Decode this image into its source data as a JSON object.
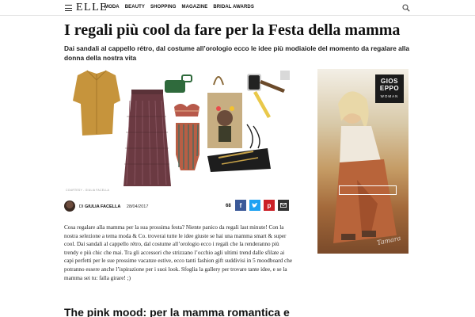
{
  "header": {
    "logo": "ELLE",
    "nav": [
      "MODA",
      "BEAUTY",
      "SHOPPING",
      "MAGAZINE",
      "BRIDAL AWARDS"
    ]
  },
  "article": {
    "title": "I regali più cool da fare per la Festa della mamma",
    "subtitle": "Dai sandali al cappello rétro, dal costume all’orologio ecco le idee più modiaiole del momento da regalare alla donna della nostra vita",
    "image_credit": "COURTESY - GIULIA FACELLA",
    "author_prefix": "DI",
    "author": "GIULIA FACELLA",
    "date": "28/04/2017",
    "share_count": "68",
    "share_icons": [
      "facebook-icon",
      "twitter-icon",
      "pinterest-icon",
      "mail-icon"
    ],
    "body": "Cosa regalare alla mamma per la sua prossima festa? Niente panico da regali last minute! Con la nostra selezione a tema moda & Co. troverai tutte le idee giuste se hai una mamma smart & super cool. Dai sandali al cappello rétro, dal costume all’orologio ecco i regali che la renderanno più trendy e più chic che mai. Tra gli accessori che strizzano l’occhio agli ultimi trend dalle sfilate ai capi perfetti per le sue prossime vacanze estive, ecco tanti fashion gift suddivisi in 5 moodboard che potranno essere anche l’ispirazione per i suoi look. Sfoglia la gallery per trovare tante idee, e se la mamma sei tu: falla girare! ;)",
    "section_title": "The pink mood: per la mamma romantica e"
  },
  "ad": {
    "brand_line1": "GIOS",
    "brand_line2": "EPPO",
    "brand_sub": "WOMAN",
    "signature": "Tamara"
  },
  "colors": {
    "facebook": "#3b5998",
    "twitter": "#1da1f2",
    "pinterest": "#cb2027",
    "mail": "#333333"
  }
}
